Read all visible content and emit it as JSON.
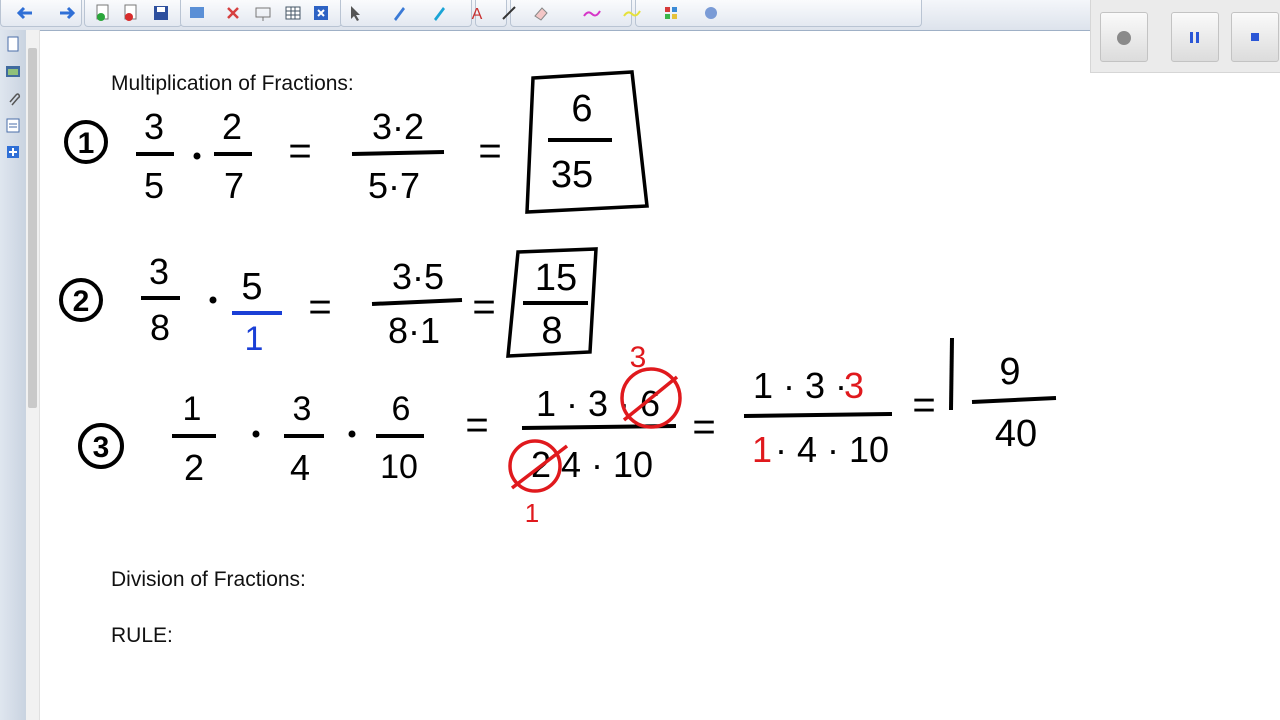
{
  "toolbar": {
    "buttons": [
      "back-arrow-icon",
      "forward-arrow-icon",
      "add-page-icon",
      "delete-page-icon",
      "save-icon",
      "screen-shade-icon",
      "delete-icon",
      "display-icon",
      "table-icon",
      "close-box-icon",
      "select-icon",
      "pen-icon",
      "magic-pen-icon",
      "text-icon",
      "line-icon",
      "eraser-icon",
      "highlighter-icon",
      "creative-pen-icon",
      "fill-icon",
      "settings-icon"
    ]
  },
  "recorder": {
    "record": "record-icon",
    "pause": "pause-icon",
    "stop": "stop-icon"
  },
  "sidebar": {
    "tabs": [
      "page-sorter-icon",
      "gallery-icon",
      "attachments-icon",
      "properties-icon",
      "addons-icon"
    ]
  },
  "headings": {
    "multiplication": "Multiplication of Fractions:",
    "division": "Division of Fractions:",
    "rule": "RULE:"
  },
  "problems": [
    {
      "label": "1",
      "terms": [
        {
          "num": "3",
          "den": "5"
        },
        {
          "num": "2",
          "den": "7"
        }
      ],
      "expanded": {
        "num": "3·2",
        "den": "5·7"
      },
      "answer": {
        "num": "6",
        "den": "35"
      }
    },
    {
      "label": "2",
      "terms": [
        {
          "num": "3",
          "den": "8"
        },
        {
          "num": "5",
          "den": "1"
        }
      ],
      "expanded": {
        "num": "3·5",
        "den": "8·1"
      },
      "answer": {
        "num": "15",
        "den": "8"
      }
    },
    {
      "label": "3",
      "terms": [
        {
          "num": "1",
          "den": "2"
        },
        {
          "num": "3",
          "den": "4"
        },
        {
          "num": "6",
          "den": "10"
        }
      ],
      "expanded": {
        "num": "1 · 3 · 6",
        "den": "2 4 · 10"
      },
      "simplified_num": [
        "1 · 3 ·",
        "3"
      ],
      "simplified_den": [
        "1",
        " · 4 · 10"
      ],
      "cancel_marks": [
        "3",
        "1"
      ],
      "answer": {
        "num": "9",
        "den": "40"
      }
    }
  ],
  "colors": {
    "ink": "#000000",
    "red": "#e0191d",
    "blue": "#1a3fd6"
  }
}
